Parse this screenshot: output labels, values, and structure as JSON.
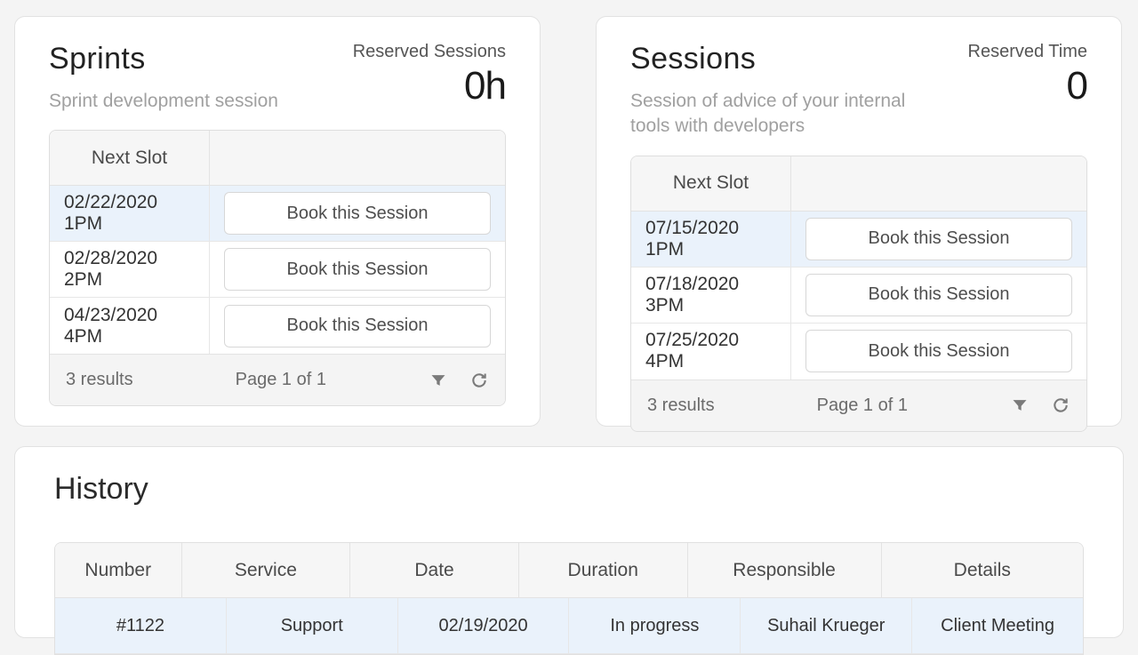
{
  "sprints": {
    "title": "Sprints",
    "subtitle": "Sprint development session",
    "reserved_label": "Reserved Sessions",
    "reserved_value": "0h",
    "column_header": "Next Slot",
    "book_label": "Book this Session",
    "rows": [
      {
        "slot": "02/22/2020 1PM"
      },
      {
        "slot": "02/28/2020 2PM"
      },
      {
        "slot": "04/23/2020 4PM"
      }
    ],
    "results": "3 results",
    "page": "Page 1 of 1"
  },
  "sessions": {
    "title": "Sessions",
    "subtitle": "Session of advice of your internal tools with developers",
    "reserved_label": "Reserved Time",
    "reserved_value": "0",
    "column_header": "Next Slot",
    "book_label": "Book this Session",
    "rows": [
      {
        "slot": "07/15/2020 1PM"
      },
      {
        "slot": "07/18/2020 3PM"
      },
      {
        "slot": "07/25/2020 4PM"
      }
    ],
    "results": "3 results",
    "page": "Page 1 of 1"
  },
  "history": {
    "title": "History",
    "columns": {
      "number": "Number",
      "service": "Service",
      "date": "Date",
      "duration": "Duration",
      "responsible": "Responsible",
      "details": "Details"
    },
    "rows": [
      {
        "number": "#1122",
        "service": "Support",
        "date": "02/19/2020",
        "duration": "In progress",
        "responsible": "Suhail Krueger",
        "details": "Client Meeting"
      }
    ]
  }
}
